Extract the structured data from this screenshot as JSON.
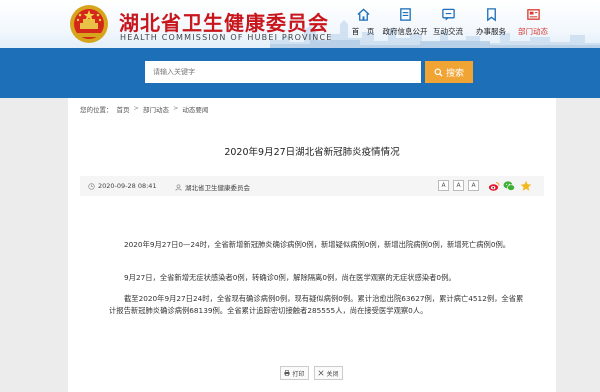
{
  "header": {
    "site_title": "湖北省卫生健康委员会",
    "site_subtitle": "HEALTH COMMISSION OF HUBEI PROVINCE",
    "nav": [
      {
        "label": "首　页",
        "icon": "home-icon",
        "active": false
      },
      {
        "label": "政府信息公开",
        "icon": "document-icon",
        "active": false
      },
      {
        "label": "互动交流",
        "icon": "chat-icon",
        "active": false
      },
      {
        "label": "办事服务",
        "icon": "bookmark-icon",
        "active": false
      },
      {
        "label": "部门动态",
        "icon": "news-icon",
        "active": true
      }
    ]
  },
  "search": {
    "placeholder": "请输入关键字",
    "button_label": "搜索"
  },
  "breadcrumb": {
    "prefix": "您的位置：",
    "items": [
      "首页",
      "部门动态",
      "动态要闻"
    ],
    "separator": ">"
  },
  "article": {
    "title": "2020年9月27日湖北省新冠肺炎疫情情况",
    "date": "2020-09-28 08:41",
    "source": "湖北省卫生健康委员会",
    "font_sizes": [
      "A",
      "A",
      "A"
    ],
    "paragraphs": [
      "2020年9月27日0—24时，全省新增新冠肺炎确诊病例0例，新增疑似病例0例，新增出院病例0例，新增死亡病例0例。",
      "9月27日，全省新增无症状感染者0例，转确诊0例，解除隔离0例，尚在医学观察的无症状感染者0例。",
      "截至2020年9月27日24时，全省现有确诊病例0例，现有疑似病例0例。累计治愈出院63627例，累计病亡4512例，全省累计报告新冠肺炎确诊病例68139例。全省累计追踪密切接触者285555人，尚在接受医学观察0人。"
    ],
    "print_label": "打印",
    "close_label": "关闭"
  },
  "colors": {
    "brand_red": "#c8161d",
    "banner_blue": "#1d6fb8",
    "search_orange": "#f0a434",
    "nav_active": "#d8392f"
  }
}
